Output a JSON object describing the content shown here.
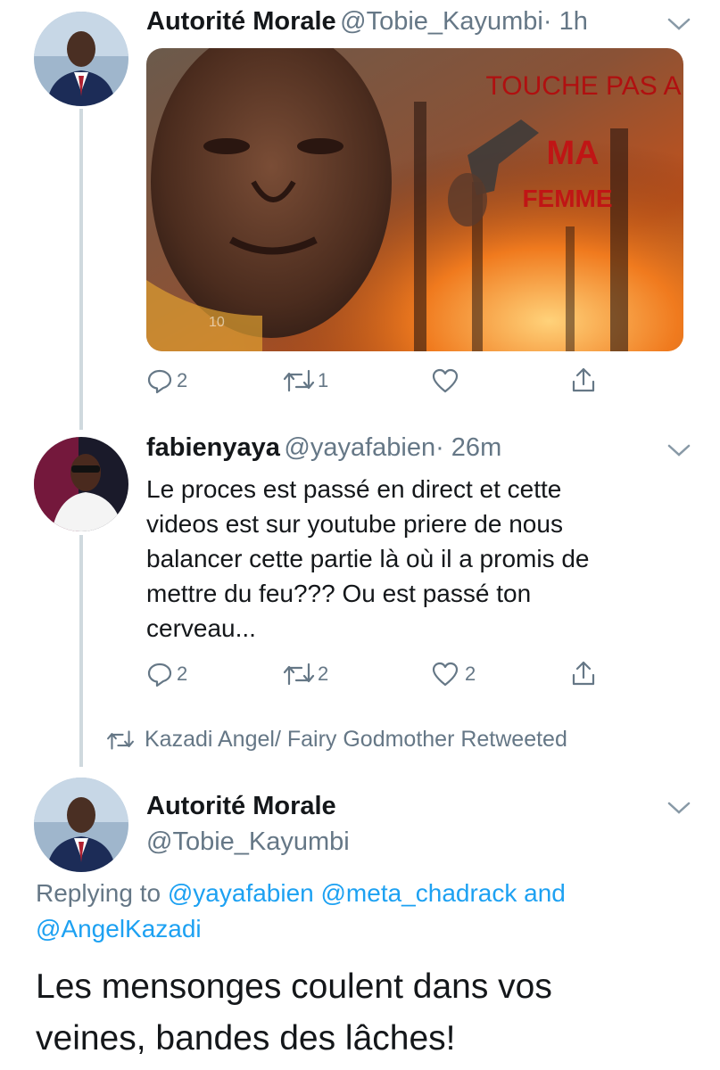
{
  "tweet1": {
    "name": "Autorité Morale",
    "handle": "@Tobie_Kayumbi",
    "time": "· 1h",
    "image": {
      "line1": "TOUCHE PAS A",
      "line2": "MA",
      "line3": "FEMME",
      "watermark": "10"
    },
    "replies": "2",
    "retweets": "1",
    "likes": ""
  },
  "tweet2": {
    "name": "fabienyaya",
    "handle": "@yayafabien",
    "time": "· 26m",
    "text_lines": [
      "Le proces est passé en direct et cette",
      "videos est sur youtube priere de nous",
      "balancer cette partie là où il a promis de",
      "mettre du feu??? Ou est passé ton",
      "cerveau..."
    ],
    "replies": "2",
    "retweets": "2",
    "likes": "2"
  },
  "retweet_notice": "Kazadi Angel/ Fairy Godmother Retweeted",
  "tweet3": {
    "name": "Autorité Morale",
    "handle": "@Tobie_Kayumbi",
    "replying_prefix": "Replying to",
    "replying_links": "@yayafabien @meta_chadrack",
    "replying_and": "and",
    "replying_last": "@AngelKazadi",
    "text_line1": "Les mensonges coulent dans vos",
    "text_line2": "veines, bandes des lâches!"
  },
  "colors": {
    "link": "#1da1f2",
    "secondary": "#657786",
    "thread_line": "#cfd9de"
  }
}
